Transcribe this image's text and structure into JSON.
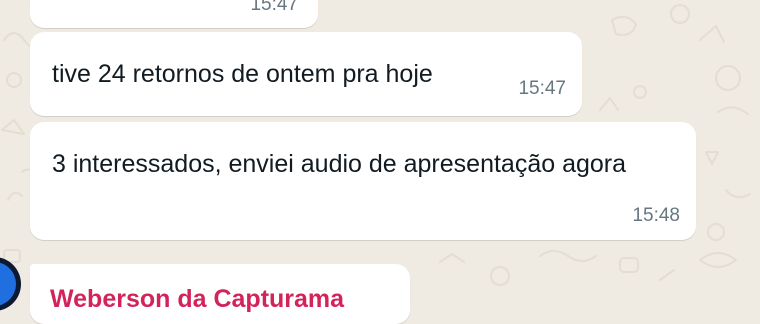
{
  "messages": {
    "previous": {
      "time": "15:47"
    },
    "first": {
      "text": "tive 24 retornos de ontem pra hoje",
      "time": "15:47"
    },
    "second": {
      "text": "3 interessados, enviei audio de apresentação agora",
      "time": "15:48"
    },
    "incoming": {
      "sender": "Weberson da Capturama",
      "sender_color": "#d2245b"
    }
  },
  "colors": {
    "chat_background": "#efeae2",
    "bubble": "#ffffff",
    "text": "#111b21",
    "timestamp": "#667781"
  }
}
